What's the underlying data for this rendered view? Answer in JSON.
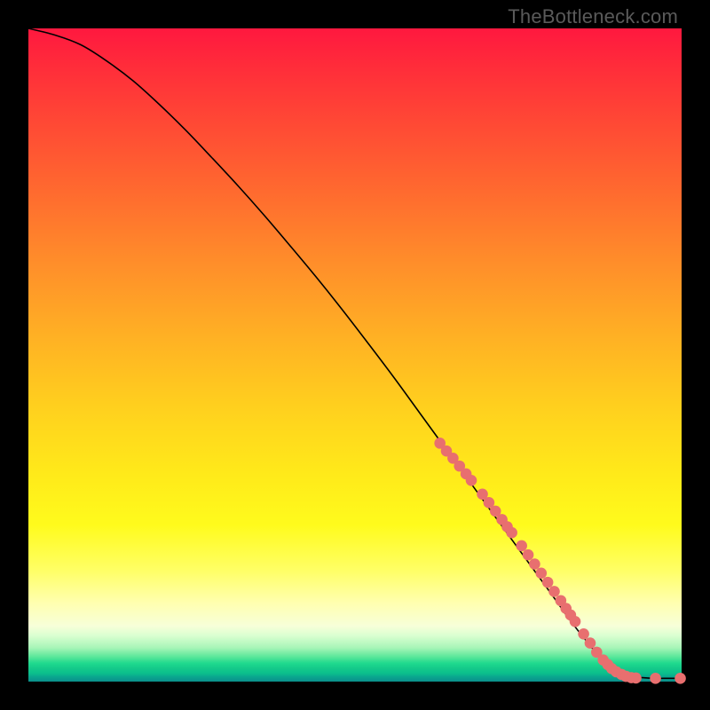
{
  "watermark": "TheBottleneck.com",
  "colors": {
    "background": "#000000",
    "curve_stroke": "#000000",
    "marker_fill": "#e86f6f",
    "marker_stroke": "#a93f3f"
  },
  "chart_data": {
    "type": "line",
    "title": "",
    "xlabel": "",
    "ylabel": "",
    "xlim": [
      0,
      100
    ],
    "ylim": [
      0,
      100
    ],
    "grid": false,
    "series": [
      {
        "name": "bottleneck-curve",
        "x": [
          0,
          4,
          8,
          12,
          16,
          20,
          24,
          28,
          32,
          36,
          40,
          44,
          48,
          52,
          56,
          60,
          64,
          68,
          72,
          76,
          80,
          83,
          86,
          88,
          90,
          92,
          94,
          96,
          98,
          100
        ],
        "y": [
          100,
          99,
          97.5,
          95,
          92,
          88.4,
          84.5,
          80.3,
          76,
          71.5,
          66.8,
          62,
          57,
          51.8,
          46.5,
          41,
          35.5,
          30,
          24.5,
          19,
          13.5,
          9.3,
          5.5,
          3.2,
          1.6,
          0.8,
          0.6,
          0.5,
          0.5,
          0.5
        ]
      }
    ],
    "markers": [
      {
        "x": 63.0,
        "y": 36.5
      },
      {
        "x": 64.0,
        "y": 35.3
      },
      {
        "x": 65.0,
        "y": 34.2
      },
      {
        "x": 66.0,
        "y": 33.0
      },
      {
        "x": 67.0,
        "y": 31.8
      },
      {
        "x": 67.8,
        "y": 30.8
      },
      {
        "x": 69.5,
        "y": 28.7
      },
      {
        "x": 70.5,
        "y": 27.4
      },
      {
        "x": 71.5,
        "y": 26.1
      },
      {
        "x": 72.5,
        "y": 24.8
      },
      {
        "x": 73.3,
        "y": 23.7
      },
      {
        "x": 74.0,
        "y": 22.8
      },
      {
        "x": 75.5,
        "y": 20.8
      },
      {
        "x": 76.5,
        "y": 19.4
      },
      {
        "x": 77.5,
        "y": 18.0
      },
      {
        "x": 78.5,
        "y": 16.6
      },
      {
        "x": 79.5,
        "y": 15.2
      },
      {
        "x": 80.5,
        "y": 13.8
      },
      {
        "x": 81.5,
        "y": 12.4
      },
      {
        "x": 82.3,
        "y": 11.2
      },
      {
        "x": 83.0,
        "y": 10.2
      },
      {
        "x": 83.7,
        "y": 9.2
      },
      {
        "x": 85.0,
        "y": 7.3
      },
      {
        "x": 86.0,
        "y": 5.9
      },
      {
        "x": 87.0,
        "y": 4.5
      },
      {
        "x": 88.0,
        "y": 3.3
      },
      {
        "x": 88.7,
        "y": 2.6
      },
      {
        "x": 89.3,
        "y": 2.0
      },
      {
        "x": 90.0,
        "y": 1.5
      },
      {
        "x": 90.8,
        "y": 1.1
      },
      {
        "x": 91.5,
        "y": 0.8
      },
      {
        "x": 92.3,
        "y": 0.6
      },
      {
        "x": 93.0,
        "y": 0.55
      },
      {
        "x": 96.0,
        "y": 0.5
      },
      {
        "x": 99.8,
        "y": 0.5
      }
    ]
  }
}
